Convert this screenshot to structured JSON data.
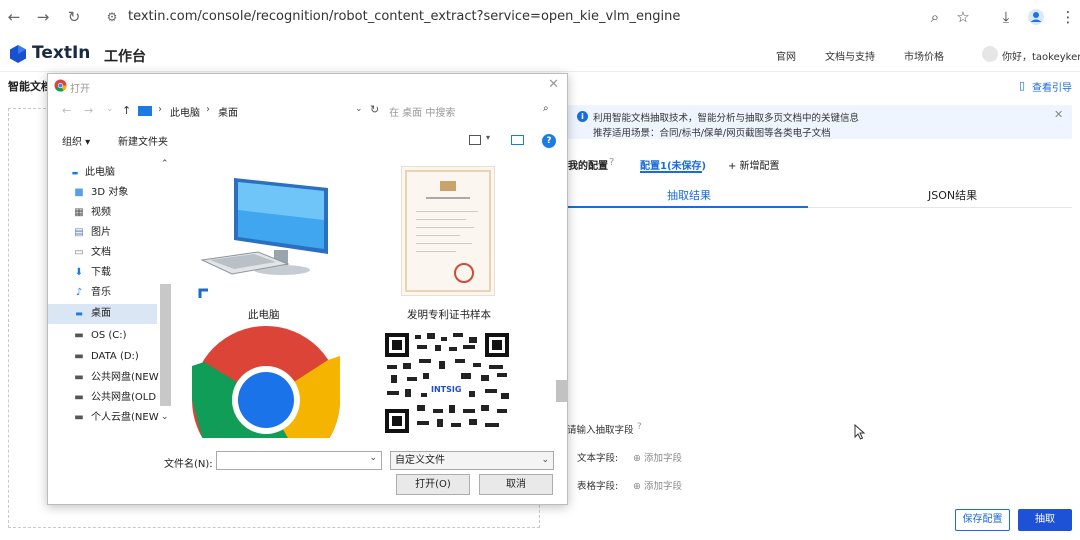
{
  "browser": {
    "url": "textin.com/console/recognition/robot_content_extract?service=open_kie_vlm_engine"
  },
  "header": {
    "brand": "TextIn",
    "workbench": "工作台",
    "nav": [
      "官网",
      "文档与支持",
      "市场价格"
    ],
    "greeting": "你好，taokeyken"
  },
  "subheader": {
    "title": "智能文档",
    "guide": "查看引导"
  },
  "banner": {
    "line1": "利用智能文档抽取技术，智能分析与抽取多页文档中的关键信息",
    "line2": "推荐适用场景：合同/标书/保单/网页截图等各类电子文档"
  },
  "config": {
    "mine": "我的配置",
    "current": "配置1(未保存)",
    "add": "+ 新增配置"
  },
  "tabs": [
    "抽取结果",
    "JSON结果"
  ],
  "fields": {
    "prompt": "请输入抽取字段",
    "text_label": "文本字段:",
    "table_label": "表格字段:",
    "add": "添加字段"
  },
  "buttons": {
    "save": "保存配置",
    "extract": "抽取"
  },
  "dialog": {
    "title": "打开",
    "path": [
      "此电脑",
      "桌面"
    ],
    "search_placeholder": "在 桌面 中搜索",
    "organize": "组织 ▾",
    "new_folder": "新建文件夹",
    "tree": [
      {
        "label": "此电脑",
        "icon": "computer-icon"
      },
      {
        "label": "3D 对象",
        "icon": "cube-icon"
      },
      {
        "label": "视频",
        "icon": "video-icon"
      },
      {
        "label": "图片",
        "icon": "picture-icon"
      },
      {
        "label": "文档",
        "icon": "document-icon"
      },
      {
        "label": "下载",
        "icon": "download-icon"
      },
      {
        "label": "音乐",
        "icon": "music-icon"
      },
      {
        "label": "桌面",
        "icon": "desktop-icon"
      },
      {
        "label": "OS (C:)",
        "icon": "drive-icon"
      },
      {
        "label": "DATA (D:)",
        "icon": "drive-icon"
      },
      {
        "label": "公共网盘(NEW",
        "icon": "network-drive-icon"
      },
      {
        "label": "公共网盘(OLD",
        "icon": "network-drive-icon"
      },
      {
        "label": "个人云盘(NEW",
        "icon": "network-drive-icon"
      }
    ],
    "files": [
      "此电脑",
      "发明专利证书样本"
    ],
    "qr_text": "INTSIG",
    "filename_label": "文件名(N):",
    "filetype": "自定义文件",
    "open": "打开(O)",
    "cancel": "取消"
  },
  "colors": {
    "accent": "#1a6bdc",
    "extract_btn": "#1e52d6",
    "banner_bg": "#eef5ff"
  }
}
